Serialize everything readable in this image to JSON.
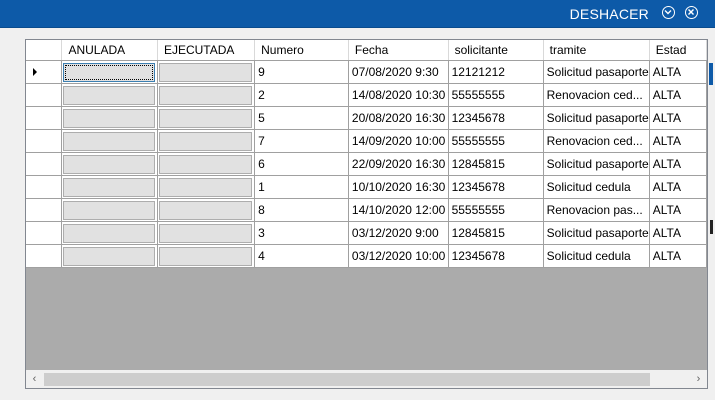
{
  "window": {
    "title": "DESHACER",
    "buttons": [
      "collapse-icon",
      "close-icon"
    ],
    "accent_color": "#0d5aa8"
  },
  "grid": {
    "columns": [
      "ANULADA",
      "EJECUTADA",
      "Numero",
      "Fecha",
      "solicitante",
      "tramite",
      "Estad"
    ],
    "rows": [
      {
        "numero": "9",
        "fecha": "07/08/2020 9:30",
        "solicitante": "12121212",
        "tramite": "Solicitud pasaporte",
        "estado": "ALTA"
      },
      {
        "numero": "2",
        "fecha": "14/08/2020 10:30",
        "solicitante": "55555555",
        "tramite": "Renovacion ced...",
        "estado": "ALTA"
      },
      {
        "numero": "5",
        "fecha": "20/08/2020 16:30",
        "solicitante": "12345678",
        "tramite": "Solicitud pasaporte",
        "estado": "ALTA"
      },
      {
        "numero": "7",
        "fecha": "14/09/2020 10:00",
        "solicitante": "55555555",
        "tramite": "Renovacion ced...",
        "estado": "ALTA"
      },
      {
        "numero": "6",
        "fecha": "22/09/2020 16:30",
        "solicitante": "12845815",
        "tramite": "Solicitud pasaporte",
        "estado": "ALTA"
      },
      {
        "numero": "1",
        "fecha": "10/10/2020 16:30",
        "solicitante": "12345678",
        "tramite": "Solicitud cedula",
        "estado": "ALTA"
      },
      {
        "numero": "8",
        "fecha": "14/10/2020 12:00",
        "solicitante": "55555555",
        "tramite": "Renovacion pas...",
        "estado": "ALTA"
      },
      {
        "numero": "3",
        "fecha": "03/12/2020 9:00",
        "solicitante": "12845815",
        "tramite": "Solicitud pasaporte",
        "estado": "ALTA"
      },
      {
        "numero": "4",
        "fecha": "03/12/2020 10:00",
        "solicitante": "12345678",
        "tramite": "Solicitud cedula",
        "estado": "ALTA"
      }
    ],
    "current_row_index": 0,
    "scroll_left_icon": "chevron-left-icon",
    "scroll_right_icon": "chevron-right-icon"
  }
}
